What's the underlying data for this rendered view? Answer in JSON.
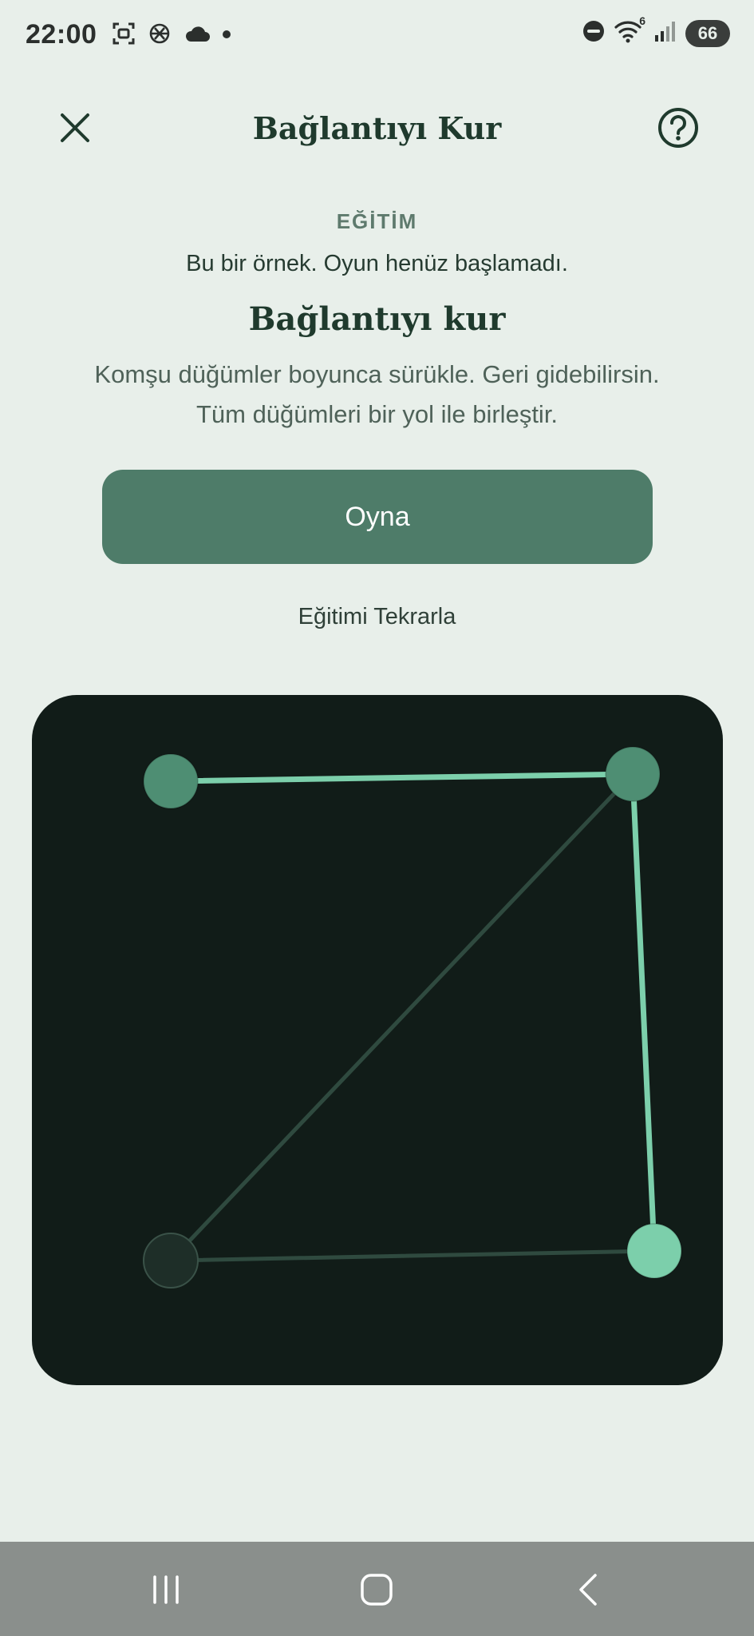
{
  "status_bar": {
    "time": "22:00",
    "left_icons": [
      "screenshot-icon",
      "chatgpt-icon",
      "cloud-icon",
      "dot-icon"
    ],
    "right_icons": [
      "dnd-icon",
      "wifi-icon",
      "signal-icon"
    ],
    "wifi_label": "6",
    "battery": "66"
  },
  "header": {
    "title": "Bağlantıyı Kur",
    "close_icon": "close-icon",
    "help_icon": "help-icon"
  },
  "tutorial": {
    "section_label": "EĞİTİM",
    "sample_note": "Bu bir örnek. Oyun henüz başlamadı.",
    "game_title": "Bağlantıyı kur",
    "instructions_line1": "Komşu düğümler boyunca sürükle. Geri gidebilirsin.",
    "instructions_line2": "Tüm düğümleri bir yol ile birleştir.",
    "play_label": "Oyna",
    "replay_label": "Eğitimi Tekrarla"
  },
  "board": {
    "background": "#111c18",
    "nodes": [
      {
        "id": "top-left",
        "fill": "#4e8e73",
        "state": "visited"
      },
      {
        "id": "top-right",
        "fill": "#4e8e73",
        "state": "visited"
      },
      {
        "id": "bottom-left",
        "fill": "#1e2e28",
        "state": "unvisited"
      },
      {
        "id": "bottom-right",
        "fill": "#7ccfab",
        "state": "current"
      }
    ],
    "edges": [
      {
        "from": "top-left",
        "to": "top-right",
        "state": "active"
      },
      {
        "from": "top-right",
        "to": "bottom-right",
        "state": "active"
      },
      {
        "from": "top-right",
        "to": "bottom-left",
        "state": "inactive"
      },
      {
        "from": "bottom-left",
        "to": "bottom-right",
        "state": "inactive"
      }
    ],
    "active_edge_color": "#7ccfab",
    "inactive_edge_color": "#2f4a3f"
  },
  "nav_bar": {
    "icons": [
      "recents-icon",
      "home-icon",
      "back-icon"
    ]
  }
}
